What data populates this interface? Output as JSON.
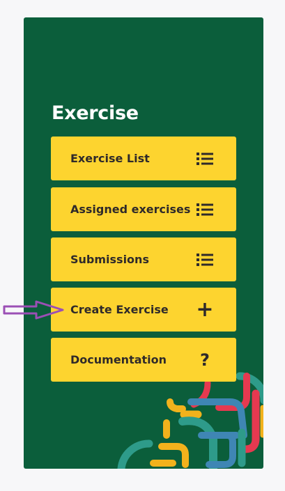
{
  "panel": {
    "title": "Exercise",
    "colors": {
      "background": "#0b5e3b",
      "button": "#fdd42f",
      "text": "#2f2a2a"
    }
  },
  "menu": [
    {
      "label": "Exercise List",
      "icon": "list-icon"
    },
    {
      "label": "Assigned exercises",
      "icon": "list-icon"
    },
    {
      "label": "Submissions",
      "icon": "list-icon"
    },
    {
      "label": "Create Exercise",
      "icon": "plus-icon"
    },
    {
      "label": "Documentation",
      "icon": "question-icon"
    }
  ],
  "annotation": {
    "icon": "arrow-icon",
    "color": "#9b4fb5",
    "target": "Create Exercise"
  },
  "icons": {
    "plus": "+",
    "question": "?"
  }
}
